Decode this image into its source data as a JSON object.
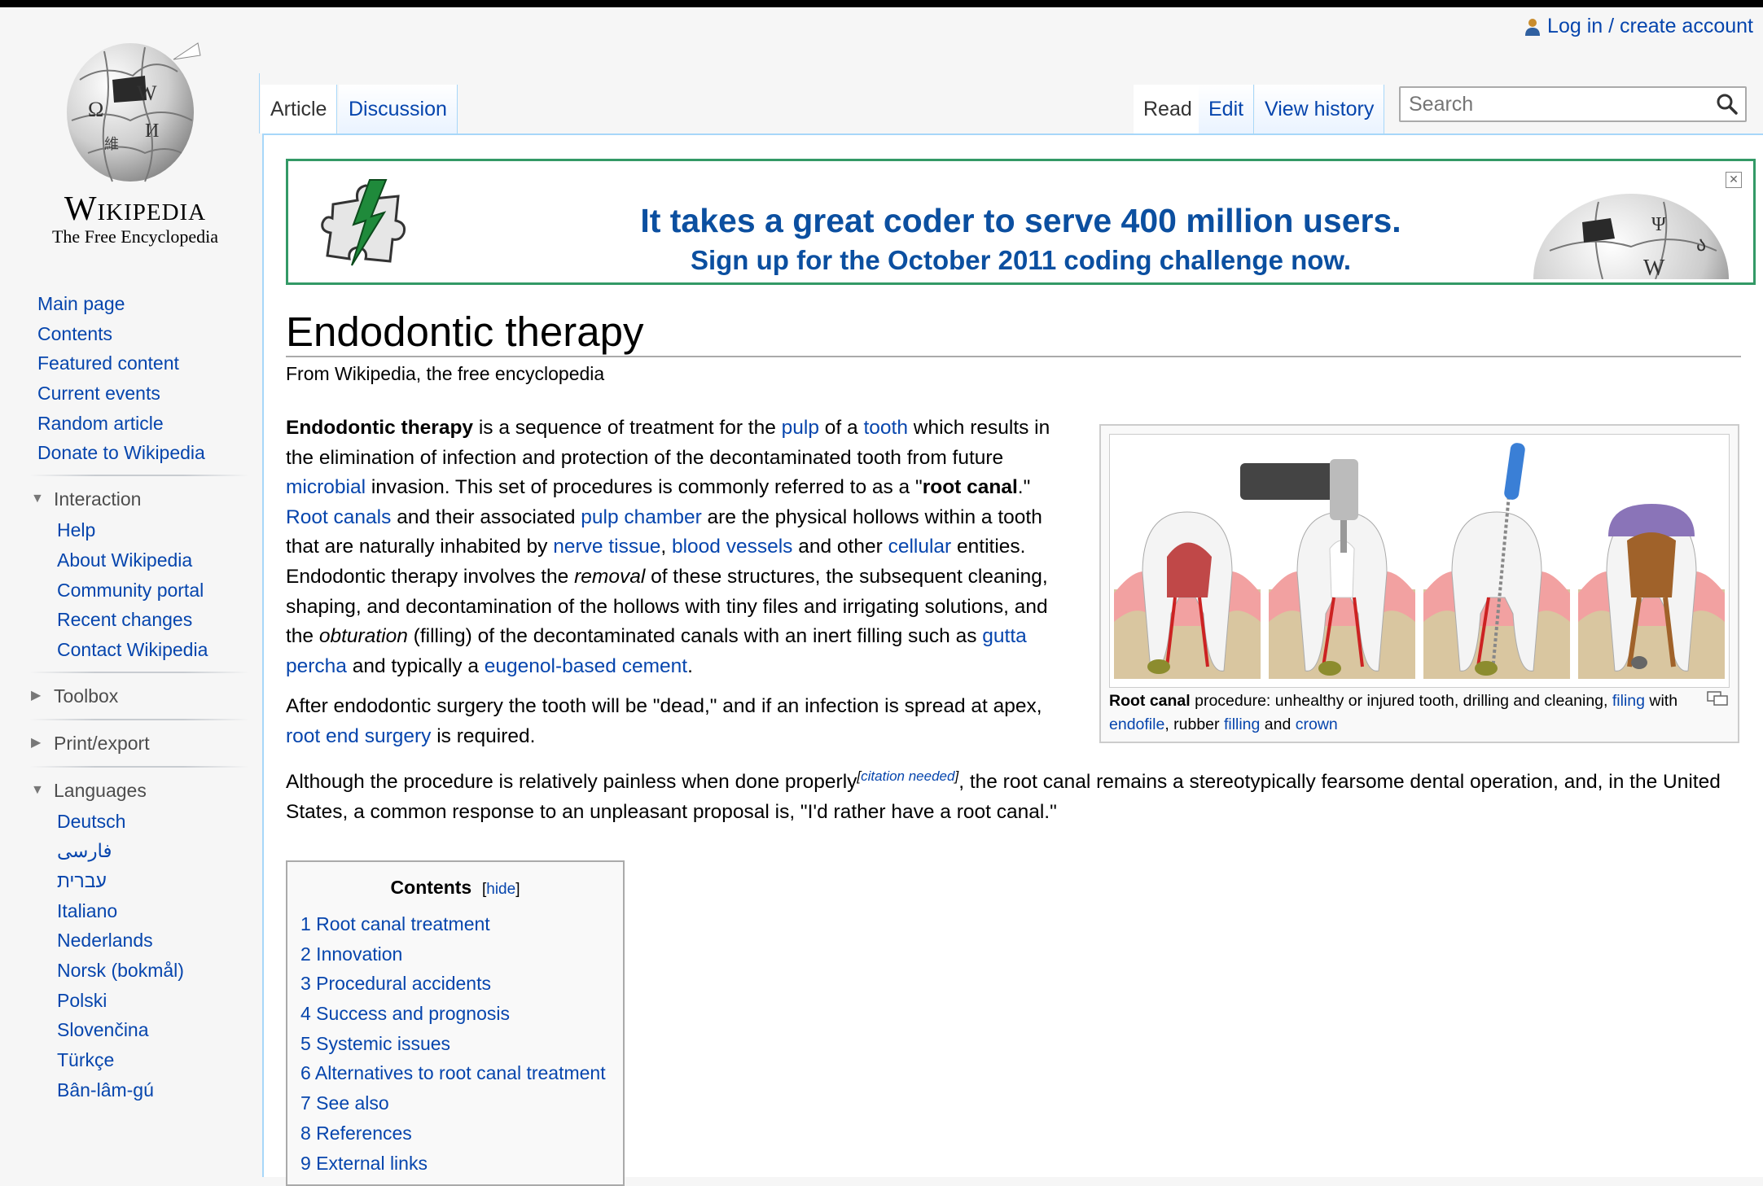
{
  "personal": {
    "login": "Log in / create account"
  },
  "logo": {
    "wordmark": "Wikipedia",
    "tagline": "The Free Encyclopedia"
  },
  "nav": {
    "items": [
      "Main page",
      "Contents",
      "Featured content",
      "Current events",
      "Random article",
      "Donate to Wikipedia"
    ]
  },
  "interaction": {
    "heading": "Interaction",
    "items": [
      "Help",
      "About Wikipedia",
      "Community portal",
      "Recent changes",
      "Contact Wikipedia"
    ]
  },
  "toolbox": {
    "heading": "Toolbox"
  },
  "printexport": {
    "heading": "Print/export"
  },
  "languages": {
    "heading": "Languages",
    "items": [
      "Deutsch",
      "فارسی",
      "עברית",
      "Italiano",
      "Nederlands",
      "Norsk (bokmål)",
      "Polski",
      "Slovenčina",
      "Türkçe",
      "Bân-lâm-gú"
    ]
  },
  "tabs": {
    "article": "Article",
    "discussion": "Discussion",
    "read": "Read",
    "edit": "Edit",
    "history": "View history"
  },
  "search": {
    "placeholder": "Search"
  },
  "banner": {
    "line1": "It takes a great coder to serve 400 million users.",
    "line2": "Sign up for the October 2011 coding challenge now."
  },
  "article": {
    "title": "Endodontic therapy",
    "subtitle": "From Wikipedia, the free encyclopedia",
    "p1": {
      "t1": "Endodontic therapy",
      "t2": " is a sequence of treatment for the ",
      "l_pulp": "pulp",
      "t3": " of a ",
      "l_tooth": "tooth",
      "t4": " which results in the elimination of infection and protection of the decontaminated tooth from future ",
      "l_microbial": "microbial",
      "t5": " invasion. This set of procedures is commonly referred to as a \"",
      "b_rootcanal": "root canal",
      "t6": ".\" ",
      "l_rootcanals": "Root canals",
      "t7": " and their associated ",
      "l_pulpchamber": "pulp chamber",
      "t8": " are the physical hollows within a tooth that are naturally inhabited by ",
      "l_nerve": "nerve tissue",
      "t9": ", ",
      "l_blood": "blood vessels",
      "t10": " and other ",
      "l_cellular": "cellular",
      "t11": " entities. Endodontic therapy involves the ",
      "i_removal": "removal",
      "t12": " of these structures, the subsequent cleaning, shaping, and decontamination of the hollows with tiny files and irrigating solutions, and the ",
      "i_obturation": "obturation",
      "t13": " (filling) of the decontaminated canals with an inert filling such as ",
      "l_gutta": "gutta percha",
      "t14": " and typically a ",
      "l_eugenol": "eugenol-based cement",
      "t15": "."
    },
    "p2": {
      "t1": "After endodontic surgery the tooth will be \"dead,\" and if an infection is spread at apex, ",
      "l_rootend": "root end surgery",
      "t2": " is required."
    },
    "p3": {
      "t1": "Although the procedure is relatively painless when done properly",
      "sup_open": "[",
      "citation": "citation needed",
      "sup_close": "]",
      "t2": ", the root canal remains a stereotypically fearsome dental operation, and, in the United States, a common response to an unpleasant proposal is, \"I'd rather have a root canal.\""
    }
  },
  "thumb": {
    "c_bold": "Root canal",
    "c1": " procedure: unhealthy or injured tooth, drilling and cleaning, ",
    "l_filing": "filing",
    "c2": " with ",
    "l_endofile": "endofile",
    "c3": ", rubber ",
    "l_filling": "filling",
    "c4": " and ",
    "l_crown": "crown"
  },
  "toc": {
    "title": "Contents",
    "hide": "hide",
    "hide_open": "[",
    "hide_close": "]",
    "items": [
      "1 Root canal treatment",
      "2 Innovation",
      "3 Procedural accidents",
      "4 Success and prognosis",
      "5 Systemic issues",
      "6 Alternatives to root canal treatment",
      "7 See also",
      "8 References",
      "9 External links"
    ]
  },
  "colors": {
    "link": "#0645ad",
    "banner_border": "#339966",
    "banner_text": "#0b4fa0",
    "tab_border": "#a7d7f9"
  }
}
